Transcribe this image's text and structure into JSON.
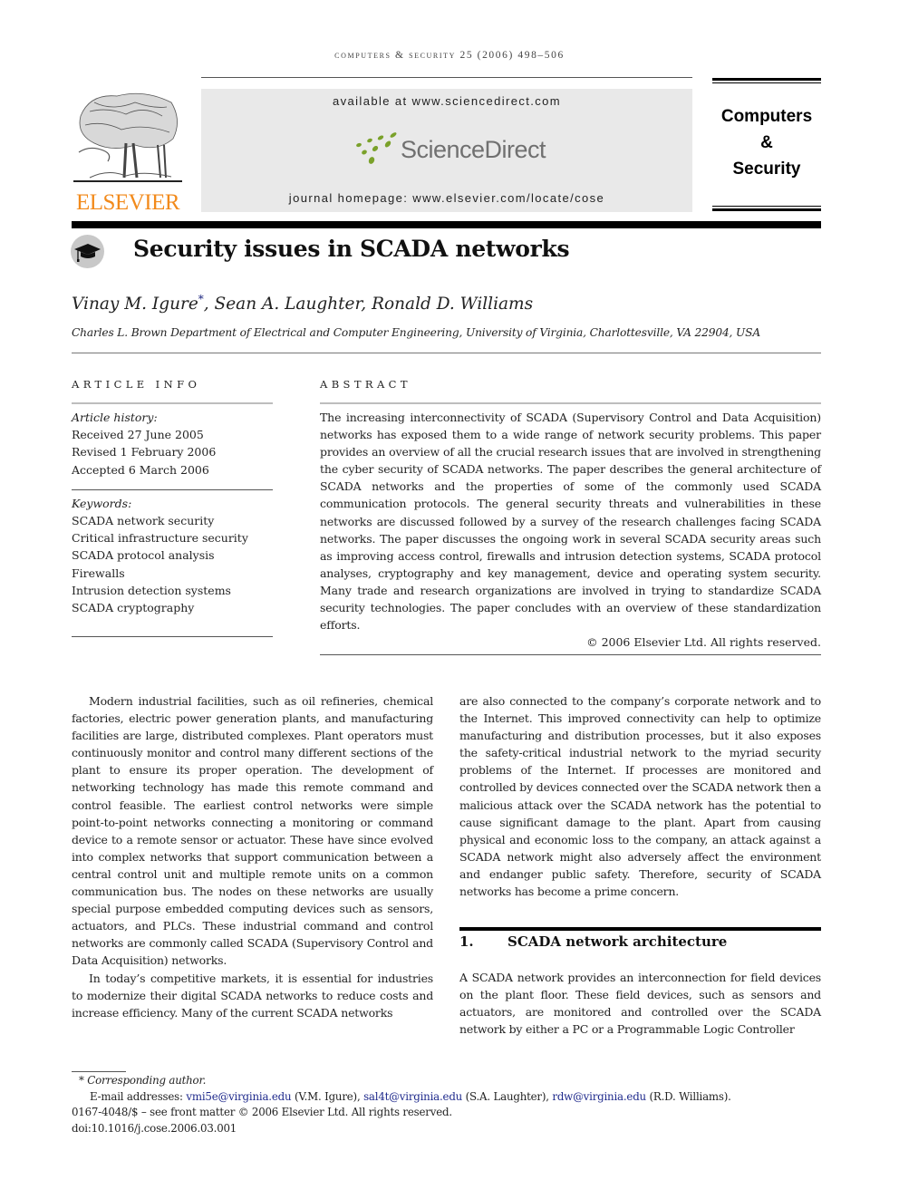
{
  "running_head": "Computers & Security 25 (2006) 498–506",
  "header": {
    "publisher_logo_text": "ELSEVIER",
    "sciencedirect": {
      "available_at": "available at www.sciencedirect.com",
      "logo_text": "ScienceDirect",
      "journal_homepage": "journal homepage: www.elsevier.com/locate/cose"
    },
    "journal_brand": {
      "line1": "Computers",
      "line2": "&",
      "line3": "Security"
    },
    "colors": {
      "elsevier_orange": "#f28a1b",
      "sciencedirect_green": "#7aa12a",
      "sciencedirect_gray": "#707070",
      "link_blue": "#1f2a8c"
    }
  },
  "article": {
    "title_icon": "graduation-cap-icon",
    "title": "Security issues in SCADA networks",
    "authors": {
      "first": "Vinay M. Igure",
      "corresponding_marker": "*",
      "rest": ", Sean A. Laughter, Ronald D. Williams"
    },
    "affiliation": "Charles L. Brown Department of Electrical and Computer Engineering, University of Virginia, Charlottesville, VA 22904, USA"
  },
  "article_info": {
    "label": "ARTICLE INFO",
    "history_label": "Article history:",
    "history": [
      "Received 27 June 2005",
      "Revised 1 February 2006",
      "Accepted 6 March 2006"
    ],
    "keywords_label": "Keywords:",
    "keywords": [
      "SCADA network security",
      "Critical infrastructure security",
      "SCADA protocol analysis",
      "Firewalls",
      "Intrusion detection systems",
      "SCADA cryptography"
    ]
  },
  "abstract": {
    "label": "ABSTRACT",
    "text": "The increasing interconnectivity of SCADA (Supervisory Control and Data Acquisition) networks has exposed them to a wide range of network security problems. This paper provides an overview of all the crucial research issues that are involved in strengthening the cyber security of SCADA networks. The paper describes the general architecture of SCADA networks and the properties of some of the commonly used SCADA communication protocols. The general security threats and vulnerabilities in these networks are discussed followed by a survey of the research challenges facing SCADA networks. The paper discusses the ongoing work in several SCADA security areas such as improving access control, firewalls and intrusion detection systems, SCADA protocol analyses, cryptography and key management, device and operating system security. Many trade and research organizations are involved in trying to standardize SCADA security technologies. The paper concludes with an overview of these standardization efforts.",
    "copyright": "© 2006 Elsevier Ltd. All rights reserved."
  },
  "body": {
    "left_paragraphs": [
      "Modern industrial facilities, such as oil refineries, chemical factories, electric power generation plants, and manufacturing facilities are large, distributed complexes. Plant operators must continuously monitor and control many different sections of the plant to ensure its proper operation. The development of networking technology has made this remote command and control feasible. The earliest control networks were simple point-to-point networks connecting a monitoring or command device to a remote sensor or actuator. These have since evolved into complex networks that support communication between a central control unit and multiple remote units on a common communication bus. The nodes on these networks are usually special purpose embedded computing devices such as sensors, actuators, and PLCs. These industrial command and control networks are commonly called SCADA (Supervisory Control and Data Acquisition) networks.",
      "In today’s competitive markets, it is essential for industries to modernize their digital SCADA networks to reduce costs and increase efficiency. Many of the current SCADA networks"
    ],
    "right_paragraph": "are also connected to the company’s corporate network and to the Internet. This improved connectivity can help to optimize manufacturing and distribution processes, but it also exposes the safety-critical industrial network to the myriad security problems of the Internet. If processes are monitored and controlled by devices connected over the SCADA network then a malicious attack over the SCADA network has the potential to cause significant damage to the plant. Apart from causing physical and economic loss to the company, an attack against a SCADA network might also adversely affect the environment and endanger public safety. Therefore, security of SCADA networks has become a prime concern.",
    "section1": {
      "number": "1.",
      "title": "SCADA network architecture",
      "text": "A SCADA network provides an interconnection for field devices on the plant floor. These field devices, such as sensors and actuators, are monitored and controlled over the SCADA network by either a PC or a Programmable Logic Controller"
    }
  },
  "footnotes": {
    "corresponding_marker": "*",
    "corresponding_label": "Corresponding author.",
    "email_label": "E-mail addresses:",
    "emails": [
      {
        "address": "vmi5e@virginia.edu",
        "owner": "(V.M. Igure)"
      },
      {
        "address": "sal4t@virginia.edu",
        "owner": "(S.A. Laughter)"
      },
      {
        "address": "rdw@virginia.edu",
        "owner": "(R.D. Williams)."
      }
    ],
    "front_matter": "0167-4048/$ – see front matter © 2006 Elsevier Ltd. All rights reserved.",
    "doi": "doi:10.1016/j.cose.2006.03.001"
  }
}
